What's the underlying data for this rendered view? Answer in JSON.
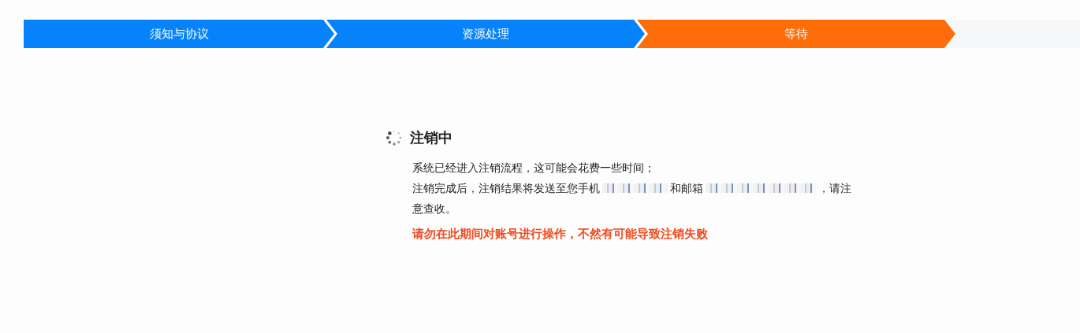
{
  "steps": [
    {
      "label": "须知与协议",
      "selected": false
    },
    {
      "label": "资源处理",
      "selected": false
    },
    {
      "label": "等待",
      "selected": true
    },
    {
      "selected": false
    }
  ],
  "result": {
    "title": "注销中",
    "loading": true,
    "lines": [
      [
        {
          "kind": "text",
          "text": "系统已经进入注销流程，这可能会花费一些时间；"
        }
      ],
      [
        {
          "kind": "text",
          "text": "注销完成后，注销结果将发送至您手机"
        },
        {
          "kind": "redacted"
        },
        {
          "kind": "text",
          "text": "和邮箱"
        },
        {
          "kind": "redacted"
        },
        {
          "kind": "text",
          "text": "，请注"
        }
      ],
      [
        {
          "kind": "text",
          "text": "意查收。"
        }
      ]
    ],
    "warning": "请勿在此期间对账号进行操作，不然有可能导致注销失败"
  }
}
